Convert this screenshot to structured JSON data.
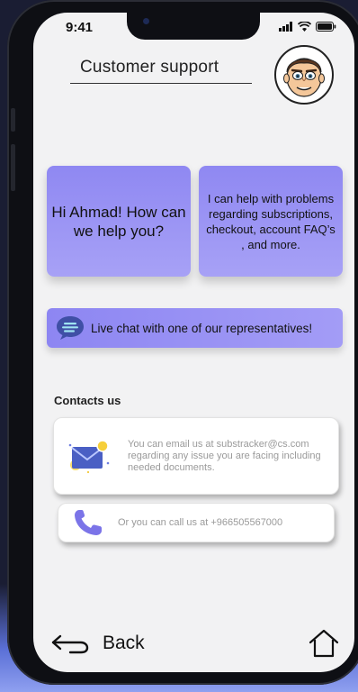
{
  "status_bar": {
    "time": "9:41"
  },
  "header": {
    "title": "Customer support"
  },
  "cards": {
    "greeting": "Hi Ahmad! How can we help you?",
    "help_text": "I can help with problems regarding subscriptions, checkout, account FAQ’s , and more."
  },
  "live_chat": {
    "label": "Live chat with one of our representatives!"
  },
  "contacts": {
    "heading": "Contacts us",
    "email_text": "You can email us at substracker@cs.com regarding any issue you are facing including needed documents.",
    "phone_text": "Or you can call us at +966505567000"
  },
  "footer": {
    "back_label": "Back"
  },
  "colors": {
    "accent": "#9a93f4",
    "screen_bg": "#f2f2f3",
    "phone_icon": "#7b74e8"
  },
  "icons": [
    "avatar",
    "chat-bubble-icon",
    "email-icon",
    "phone-icon",
    "back-arrow-icon",
    "home-icon"
  ]
}
